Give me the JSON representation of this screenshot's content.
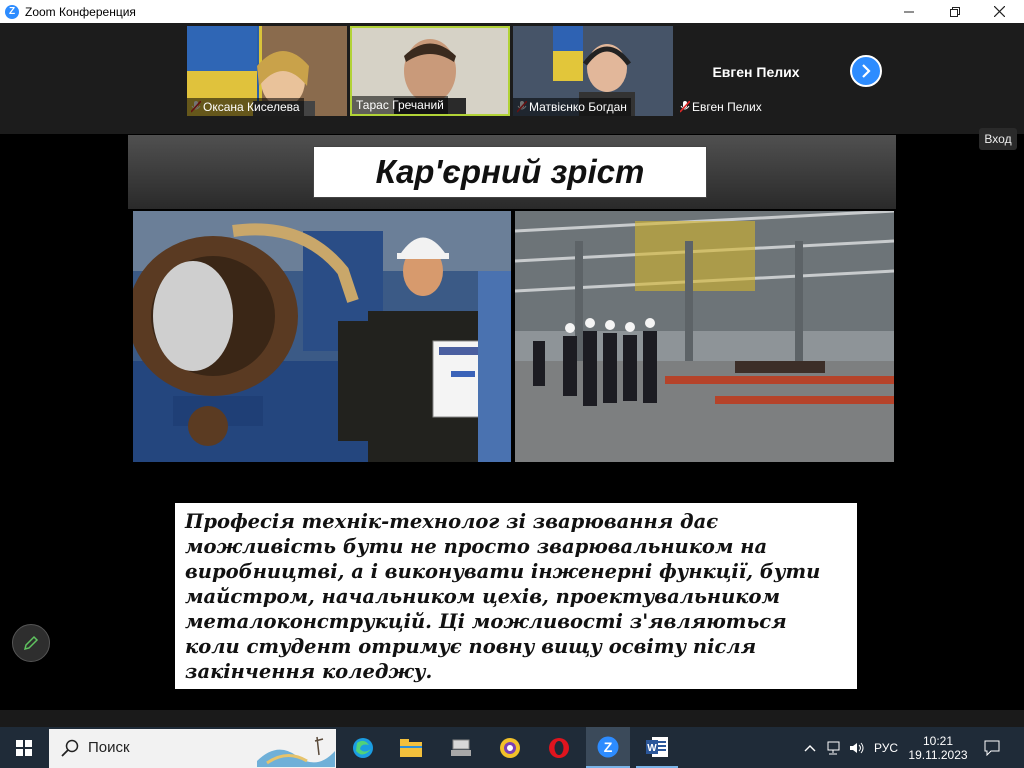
{
  "window": {
    "title": "Zoom Конференция",
    "app_icon": "zoom-logo",
    "minimize_icon": "minimize-icon",
    "maximize_icon": "restore-icon",
    "close_icon": "close-icon"
  },
  "participants": [
    {
      "name": "Оксана Киселева",
      "muted": true
    },
    {
      "name": "Тарас Гречаний",
      "muted": false
    },
    {
      "name": "Матвієнко Богдан",
      "muted": true
    },
    {
      "name": "Евген Пелих",
      "muted": true,
      "video_off": true,
      "display_name": "Евген Пелих"
    }
  ],
  "strip_next_icon": "chevron-right-icon",
  "slide": {
    "title": "Кар'єрний зріст",
    "body": "Професія технік-технолог зі зварювання дає можливість бути не просто зварювальником на виробництві, а і виконувати інженерні функції, бути майстром, начальником цехів, проектувальником металоконструкцій. Ці можливості з'являються коли студент отримує повну вищу освіту після закінчення коледжу."
  },
  "exit_button": "Вход",
  "annotate_icon": "pencil-icon",
  "taskbar": {
    "search_placeholder": "Поиск",
    "language": "РУС",
    "time": "10:21",
    "date": "19.11.2023",
    "apps": [
      "edge-icon",
      "file-explorer-icon",
      "network-tool-icon",
      "yandex-browser-icon",
      "opera-icon",
      "zoom-icon",
      "word-icon"
    ]
  }
}
